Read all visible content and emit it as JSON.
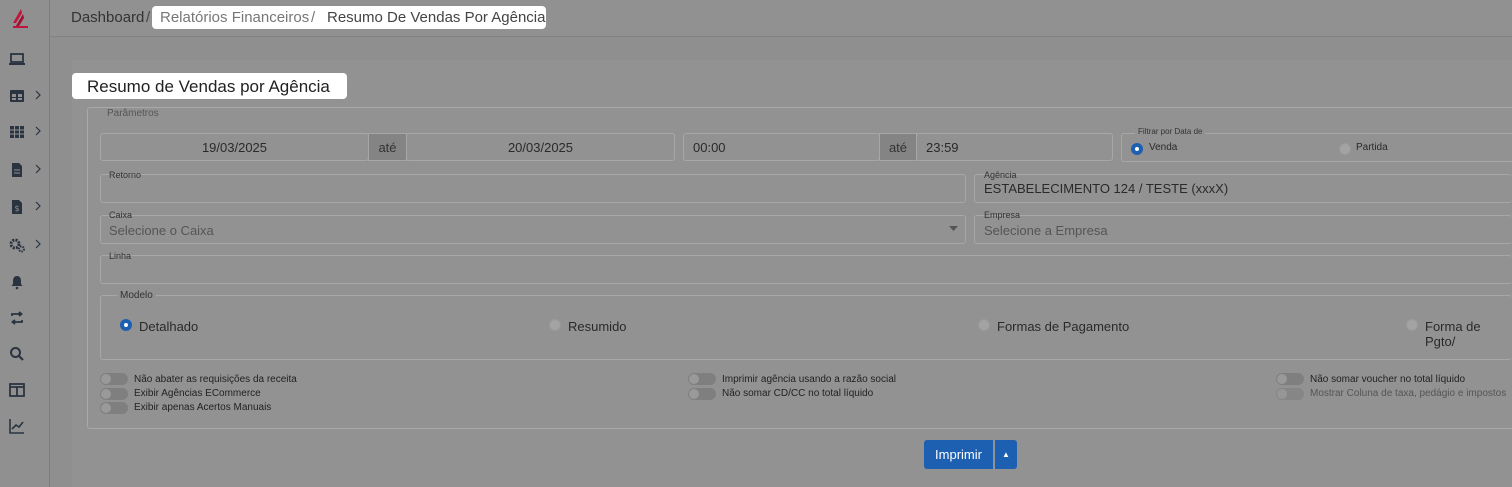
{
  "colors": {
    "accent": "#1d5fb0",
    "overlay": "#8f8f8f",
    "logo": "#c0143c"
  },
  "sidebar": {
    "items": [
      {
        "icon": "laptop-icon"
      },
      {
        "icon": "table-icon"
      },
      {
        "icon": "grid-icon"
      },
      {
        "icon": "document-icon"
      },
      {
        "icon": "dollar-document-icon"
      },
      {
        "icon": "gears-icon"
      },
      {
        "icon": "bell-icon"
      },
      {
        "icon": "exchange-icon"
      },
      {
        "icon": "search-icon"
      },
      {
        "icon": "columns-icon"
      },
      {
        "icon": "chart-line-icon"
      }
    ]
  },
  "breadcrumb": {
    "home": "Dashboard",
    "sep": "/",
    "level1": "Relatórios Financeiros",
    "level2": "Resumo De Vendas Por Agência"
  },
  "page": {
    "title": "Resumo de Vendas por Agência"
  },
  "params": {
    "legend": "Parâmetros",
    "date_from": "19/03/2025",
    "until": "até",
    "date_to": "20/03/2025",
    "time_from": "00:00",
    "time_to": "23:59",
    "filter_by": {
      "legend": "Filtrar por Data de",
      "options": [
        {
          "label": "Venda",
          "selected": true
        },
        {
          "label": "Partida",
          "selected": false
        }
      ]
    },
    "retorno_label": "Retorno",
    "retorno_value": "",
    "agencia_label": "Agência",
    "agencia_value": "ESTABELECIMENTO 124 / TESTE (xxxX)",
    "caixa_label": "Caixa",
    "caixa_placeholder": "Selecione o Caixa",
    "empresa_label": "Empresa",
    "empresa_placeholder": "Selecione a Empresa",
    "linha_label": "Linha",
    "linha_value": "",
    "modelo": {
      "legend": "Modelo",
      "options": [
        {
          "label": "Detalhado",
          "selected": true
        },
        {
          "label": "Resumido",
          "selected": false
        },
        {
          "label": "Formas de Pagamento",
          "selected": false
        },
        {
          "label": "Forma de Pgto/",
          "selected": false
        }
      ]
    },
    "toggles": [
      {
        "label": "Não abater as requisições da receita",
        "on": false
      },
      {
        "label": "Exibir Agências ECommerce",
        "on": false
      },
      {
        "label": "Exibir apenas Acertos Manuais",
        "on": false
      },
      {
        "label": "Imprimir agência usando a razão social",
        "on": false
      },
      {
        "label": "Não somar CD/CC no total líquido",
        "on": false
      },
      {
        "label": "Não somar voucher no total líquido",
        "on": false
      },
      {
        "label": "Mostrar Coluna de taxa, pedágio e impostos",
        "on": false
      }
    ]
  },
  "actions": {
    "print_label": "Imprimir"
  }
}
